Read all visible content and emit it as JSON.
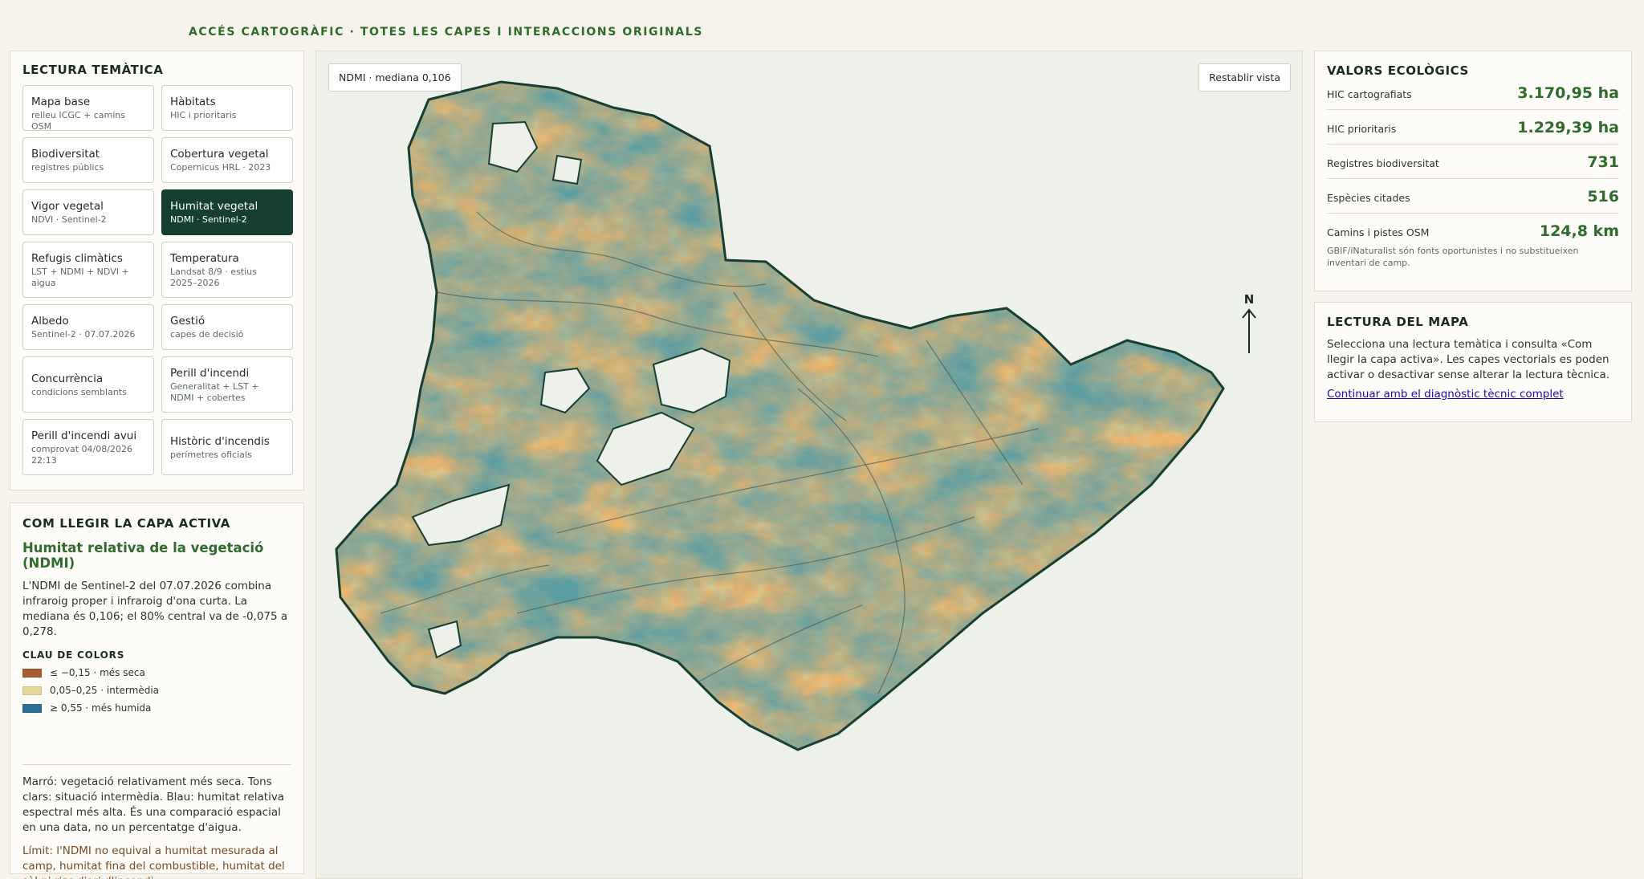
{
  "header": {
    "title": "ACCÉS CARTOGRÀFIC · TOTES LES CAPES I INTERACCIONS ORIGINALS"
  },
  "themes": {
    "title": "LECTURA TEMÀTICA",
    "items": [
      {
        "label": "Mapa base",
        "sub": "relleu ICGC + camins OSM"
      },
      {
        "label": "Hàbitats",
        "sub": "HIC i prioritaris"
      },
      {
        "label": "Biodiversitat",
        "sub": "registres públics"
      },
      {
        "label": "Cobertura vegetal",
        "sub": "Copernicus HRL · 2023"
      },
      {
        "label": "Vigor vegetal",
        "sub": "NDVI · Sentinel-2"
      },
      {
        "label": "Humitat vegetal",
        "sub": "NDMI · Sentinel-2"
      },
      {
        "label": "Refugis climàtics",
        "sub": "LST + NDMI + NDVI + aigua"
      },
      {
        "label": "Temperatura",
        "sub": "Landsat 8/9 · estius 2025–2026"
      },
      {
        "label": "Albedo",
        "sub": "Sentinel-2 · 07.07.2026"
      },
      {
        "label": "Gestió",
        "sub": "capes de decisió"
      },
      {
        "label": "Concurrència",
        "sub": "condicions semblants"
      },
      {
        "label": "Perill d'incendi",
        "sub": "Generalitat + LST + NDMI + cobertes"
      },
      {
        "label": "Perill d'incendi avui",
        "sub": "comprovat 04/08/2026 22:13"
      },
      {
        "label": "Històric d'incendis",
        "sub": "perímetres oficials"
      }
    ]
  },
  "legend": {
    "title": "COM LLEGIR LA CAPA ACTIVA",
    "subtitle": "Humitat relativa de la vegetació (NDMI)",
    "description": "L'NDMI de Sentinel-2 del 07.07.2026 combina infraroig proper i infraroig d'ona curta. La mediana és 0,106; el 80% central va de -0,075 a 0,278.",
    "key_title": "CLAU DE COLORS",
    "keys": [
      {
        "label": "≤ −0,15 · més seca",
        "color": "#a85a32"
      },
      {
        "label": "0,05–0,25 · intermèdia",
        "color": "#e6d99a"
      },
      {
        "label": "≥ 0,55 · més humida",
        "color": "#2b6f9a"
      }
    ],
    "note": "Marró: vegetació relativament més seca. Tons clars: situació intermèdia. Blau: humitat relativa espectral més alta. És una comparació espacial en una data, no un percentatge d'aigua.",
    "limit": "Límit: l'NDMI no equival a humitat mesurada al camp, humitat fina del combustible, humitat del sòl ni risc diari d'incendi."
  },
  "map": {
    "chip": "NDMI · mediana 0,106",
    "reset": "Restablir vista",
    "north": "N",
    "colors": {
      "dry": "#e9b46e",
      "mid": "#cfd2a4",
      "wet": "#5d9ea3",
      "outline": "#173f31"
    }
  },
  "values": {
    "title": "VALORS ECOLÒGICS",
    "stats": [
      {
        "label": "HIC cartografiats",
        "value": "3.170,95 ha"
      },
      {
        "label": "HIC prioritaris",
        "value": "1.229,39 ha"
      },
      {
        "label": "Registres biodiversitat",
        "value": "731"
      },
      {
        "label": "Espècies citades",
        "value": "516"
      },
      {
        "label": "Camins i pistes OSM",
        "value": "124,8 km"
      }
    ],
    "footnote": "GBIF/iNaturalist són fonts oportunistes i no substitueixen inventari de camp."
  },
  "reading": {
    "title": "LECTURA DEL MAPA",
    "text": "Selecciona una lectura temàtica i consulta «Com llegir la capa activa». Les capes vectorials es poden activar o desactivar sense alterar la lectura tècnica.",
    "link": "Continuar amb el diagnòstic tècnic complet"
  }
}
